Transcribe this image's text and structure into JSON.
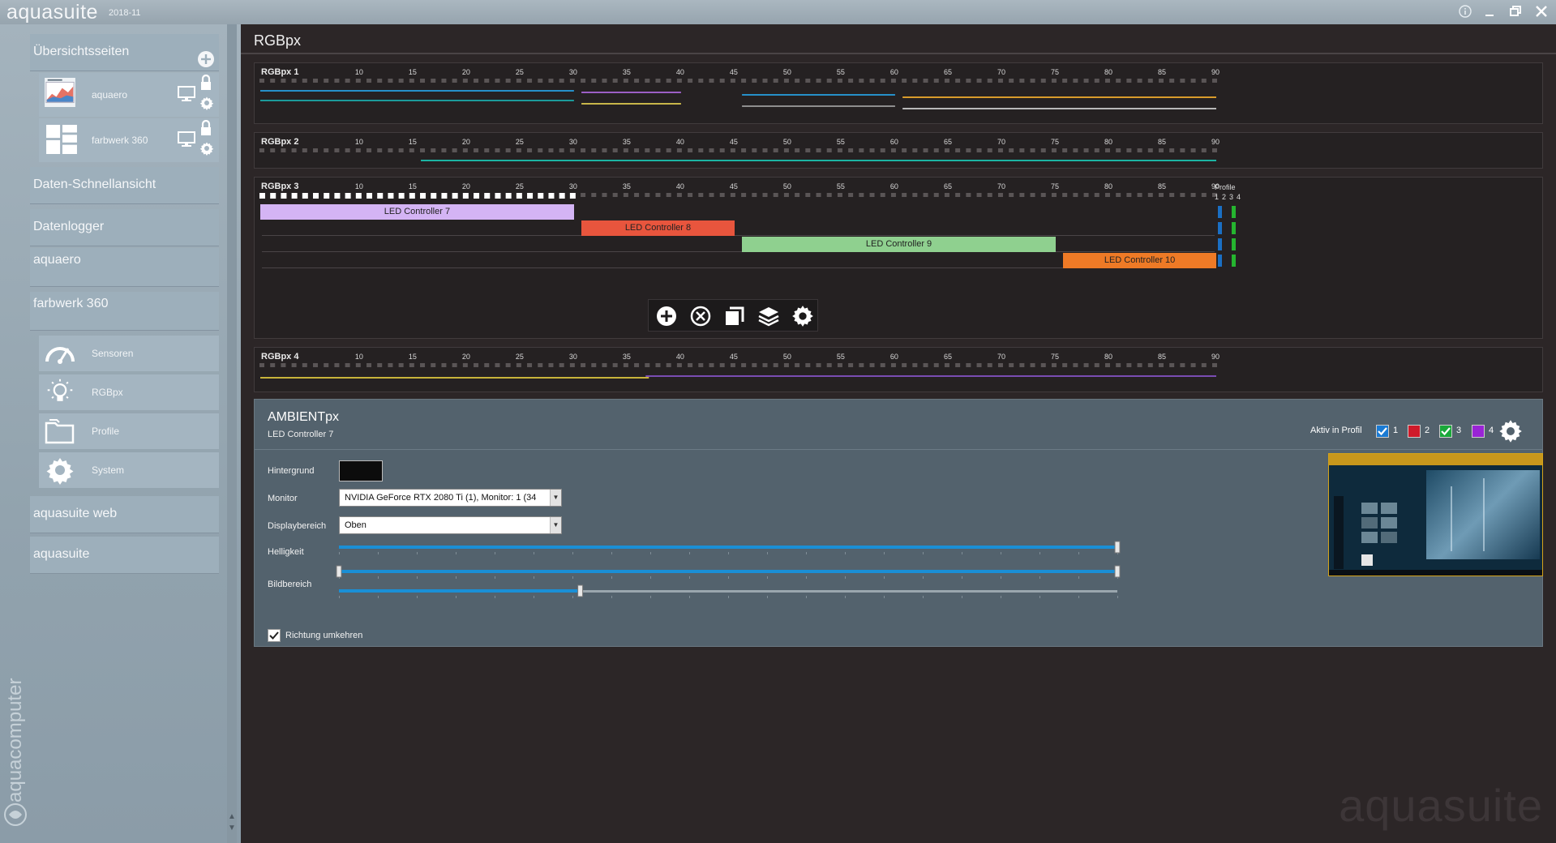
{
  "app": {
    "name": "aquasuite",
    "version": "2018-11",
    "colors": {
      "accent": "#1a8fd6",
      "sidebar": "#9dafbb",
      "background": "#2c2627"
    }
  },
  "sidebar": {
    "overview_label": "Übersichtsseiten",
    "overview_items": [
      {
        "label": "aquaero",
        "icon": "chart-thumbnail-icon"
      },
      {
        "label": "farbwerk 360",
        "icon": "grid-thumbnail-icon"
      }
    ],
    "nav_items": [
      {
        "label": "Daten-Schnellansicht"
      },
      {
        "label": "Datenlogger"
      },
      {
        "label": "aquaero"
      },
      {
        "label": "farbwerk 360"
      }
    ],
    "sub_items": [
      {
        "label": "Sensoren",
        "icon": "gauge-icon"
      },
      {
        "label": "RGBpx",
        "icon": "lightbulb-icon"
      },
      {
        "label": "Profile",
        "icon": "folder-icon"
      },
      {
        "label": "System",
        "icon": "gear-icon"
      }
    ],
    "bottom_items": [
      {
        "label": "aquasuite web"
      },
      {
        "label": "aquasuite"
      }
    ],
    "brand": "aquacomputer"
  },
  "page": {
    "title": "RGBpx",
    "ruler_ticks": [
      "10",
      "15",
      "20",
      "25",
      "30",
      "35",
      "40",
      "45",
      "50",
      "55",
      "60",
      "65",
      "70",
      "75",
      "80",
      "85",
      "90"
    ],
    "strips": [
      {
        "name": "RGBpx 1"
      },
      {
        "name": "RGBpx 2"
      },
      {
        "name": "RGBpx 3",
        "profile_label": "Profile",
        "profile_nums": [
          "1",
          "2",
          "3",
          "4"
        ]
      },
      {
        "name": "RGBpx 4"
      }
    ],
    "controllers": [
      {
        "label": "LED Controller 7",
        "color": "#d4b4f4",
        "start": 1,
        "end": 30
      },
      {
        "label": "LED Controller 8",
        "color": "#e8553d",
        "start": 31,
        "end": 45
      },
      {
        "label": "LED Controller 9",
        "color": "#8fd08f",
        "start": 46,
        "end": 75
      },
      {
        "label": "LED Controller 10",
        "color": "#ee7a26",
        "start": 76,
        "end": 90
      }
    ]
  },
  "ambient": {
    "title": "AMBIENTpx",
    "subtitle": "LED Controller 7",
    "aktiv_label": "Aktiv in Profil",
    "profiles": [
      {
        "num": "1",
        "color": "#1a7bd4",
        "checked": true
      },
      {
        "num": "2",
        "color": "#d01a2a",
        "checked": false
      },
      {
        "num": "3",
        "color": "#1aa83a",
        "checked": true
      },
      {
        "num": "4",
        "color": "#9a24d6",
        "checked": false
      }
    ],
    "hintergrund_label": "Hintergrund",
    "monitor_label": "Monitor",
    "monitor_value": "NVIDIA GeForce RTX 2080 Ti (1), Monitor: 1 (34",
    "displaybereich_label": "Displaybereich",
    "displaybereich_value": "Oben",
    "helligkeit_label": "Helligkeit",
    "helligkeit_value": 1.0,
    "bildbereich_label": "Bildbereich",
    "bildbereich_start": 0.0,
    "bildbereich_end": 1.0,
    "third_slider_value": 0.31,
    "richtung_label": "Richtung umkehren",
    "richtung_checked": true
  }
}
